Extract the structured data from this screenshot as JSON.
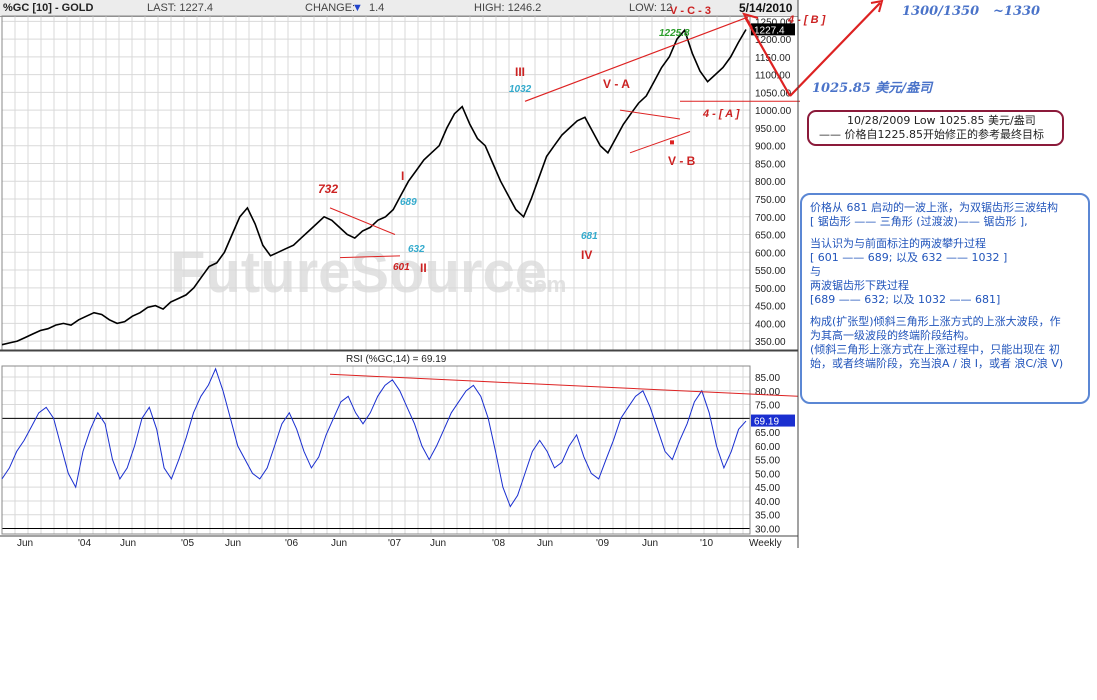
{
  "header": {
    "title": "%GC [10] - GOLD",
    "last_label": "LAST: 1227.4",
    "change_label": "CHANGE:",
    "change_value": "1.4",
    "high_label": "HIGH: 1246.2",
    "low_label": "LOW: 12",
    "date": "5/14/2010"
  },
  "watermark": {
    "text": "FutureSource",
    "suffix": ".com"
  },
  "rsi_title": "RSI (%GC,14) = 69.19",
  "x_axis": {
    "labels": [
      "Jun",
      "'04",
      "Jun",
      "'05",
      "Jun",
      "'06",
      "Jun",
      "'07",
      "Jun",
      "'08",
      "Jun",
      "'09",
      "Jun",
      "'10",
      "Weekly"
    ]
  },
  "colors": {
    "price": "#000000",
    "rsi": "#1a2fd0",
    "trend": "#dd2222",
    "accent": "#4a73c9",
    "note_border": "#8b1a3a",
    "note2_border": "#5b87d4"
  },
  "chart_data": [
    {
      "type": "line",
      "title": "%GC [10] - GOLD",
      "frequency": "Weekly",
      "ylim": [
        325,
        1265
      ],
      "y_ticks": [
        350,
        400,
        450,
        500,
        550,
        600,
        650,
        700,
        750,
        800,
        850,
        900,
        950,
        1000,
        1050,
        1100,
        1150,
        1200,
        1250
      ],
      "x_labels": [
        "Jun",
        "'04",
        "Jun",
        "'05",
        "Jun",
        "'06",
        "Jun",
        "'07",
        "Jun",
        "'08",
        "Jun",
        "'09",
        "Jun",
        "'10"
      ],
      "last_value": "1227.4",
      "series": [
        {
          "values": [
            340,
            345,
            350,
            360,
            370,
            380,
            385,
            395,
            400,
            395,
            410,
            420,
            430,
            425,
            410,
            400,
            405,
            420,
            430,
            445,
            450,
            440,
            460,
            470,
            480,
            500,
            530,
            560,
            570,
            600,
            650,
            700,
            725,
            680,
            620,
            590,
            600,
            610,
            620,
            640,
            660,
            680,
            700,
            690,
            670,
            650,
            640,
            660,
            670,
            690,
            700,
            720,
            760,
            800,
            830,
            860,
            880,
            900,
            950,
            990,
            1010,
            960,
            920,
            900,
            850,
            800,
            760,
            720,
            700,
            750,
            810,
            870,
            900,
            930,
            950,
            970,
            980,
            940,
            900,
            880,
            920,
            960,
            990,
            1020,
            1040,
            1080,
            1120,
            1150,
            1200,
            1225,
            1160,
            1110,
            1080,
            1100,
            1120,
            1150,
            1190,
            1227
          ]
        }
      ],
      "annotations": [
        "732",
        "I",
        "689",
        "632",
        "II",
        "601",
        "III",
        "1032",
        "IV",
        "681",
        "V - A",
        "V - B",
        "4 - [ A ]",
        "V - C - 3",
        "1225.8",
        "4 - [ B ]"
      ]
    },
    {
      "type": "line",
      "title": "RSI (%GC,14) = 69.19",
      "ylim": [
        28,
        89
      ],
      "y_ticks": [
        30,
        35,
        40,
        45,
        50,
        55,
        60,
        65,
        70,
        75,
        80,
        85
      ],
      "reference_lines": [
        70,
        30
      ],
      "last_value": "69.19",
      "series": [
        {
          "values": [
            48,
            52,
            58,
            62,
            67,
            72,
            74,
            70,
            60,
            50,
            45,
            58,
            66,
            72,
            68,
            55,
            48,
            52,
            60,
            70,
            74,
            66,
            52,
            48,
            55,
            63,
            72,
            78,
            82,
            88,
            80,
            70,
            60,
            55,
            50,
            48,
            52,
            60,
            68,
            72,
            66,
            58,
            52,
            56,
            64,
            70,
            76,
            78,
            72,
            68,
            72,
            78,
            82,
            84,
            80,
            74,
            68,
            60,
            55,
            60,
            66,
            72,
            76,
            80,
            82,
            78,
            70,
            58,
            45,
            38,
            42,
            50,
            58,
            62,
            58,
            52,
            54,
            60,
            64,
            56,
            50,
            48,
            55,
            62,
            70,
            74,
            78,
            80,
            74,
            66,
            58,
            55,
            62,
            68,
            76,
            80,
            72,
            60,
            52,
            58,
            66,
            69
          ]
        }
      ]
    }
  ],
  "labels": {
    "forecast_top": "1300/1350",
    "forecast_alt": "~1330",
    "low_price": "1025.85 美元/盎司"
  },
  "note1": {
    "line1": "10/28/2009  Low  1025.85 美元/盎司",
    "line2": "—— 价格自1225.85开始修正的参考最终目标"
  },
  "note2": {
    "lines": [
      "价格从 681 启动的一波上涨，为双锯齿形三波结构",
      "[ 锯齿形 —— 三角形 (过渡波)—— 锯齿形 ],",
      "",
      "当认识为与前面标注的两波攀升过程",
      "[ 601 —— 689;  以及 632 —— 1032 ]",
      "                    与",
      "两波锯齿形下跌过程",
      "[689 —— 632;  以及 1032 —— 681]",
      "",
      "构成(扩张型)倾斜三角形上涨方式的上涨大波段，作",
      "为其高一级波段的终端阶段结构。",
      "(倾斜三角形上涨方式在上涨过程中，只能出现在  初",
      "始，或者终端阶段，充当浪A / 浪 I，或者 浪C/浪 V)"
    ]
  }
}
